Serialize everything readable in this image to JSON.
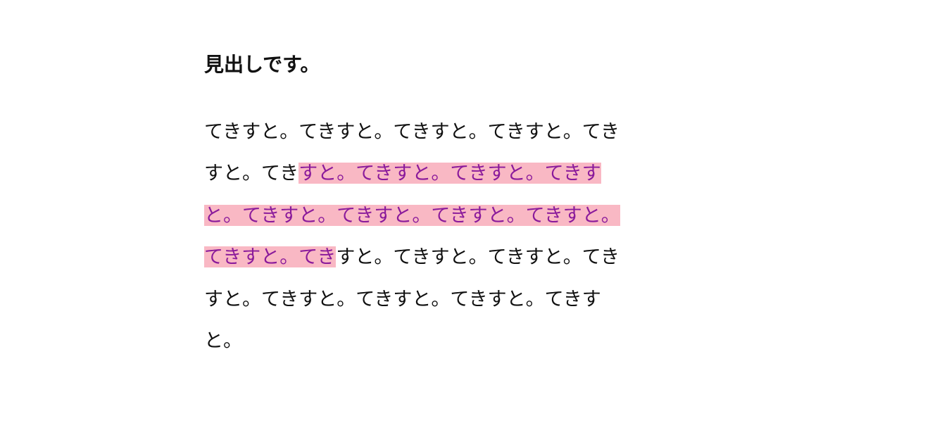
{
  "heading": "見出しです。",
  "paragraph": {
    "before": "てきすと。てきすと。てきすと。てきすと。てきすと。てき",
    "highlighted": "すと。てきすと。てきすと。てきすと。てきすと。てきすと。てきすと。てきすと。てきすと。てき",
    "after": "すと。てきすと。てきすと。てきすと。てきすと。てきすと。てきすと。てきすと。"
  },
  "colors": {
    "highlight_bg": "#f9b8c4",
    "highlight_fg": "#8a1a9b",
    "text": "#111111"
  }
}
